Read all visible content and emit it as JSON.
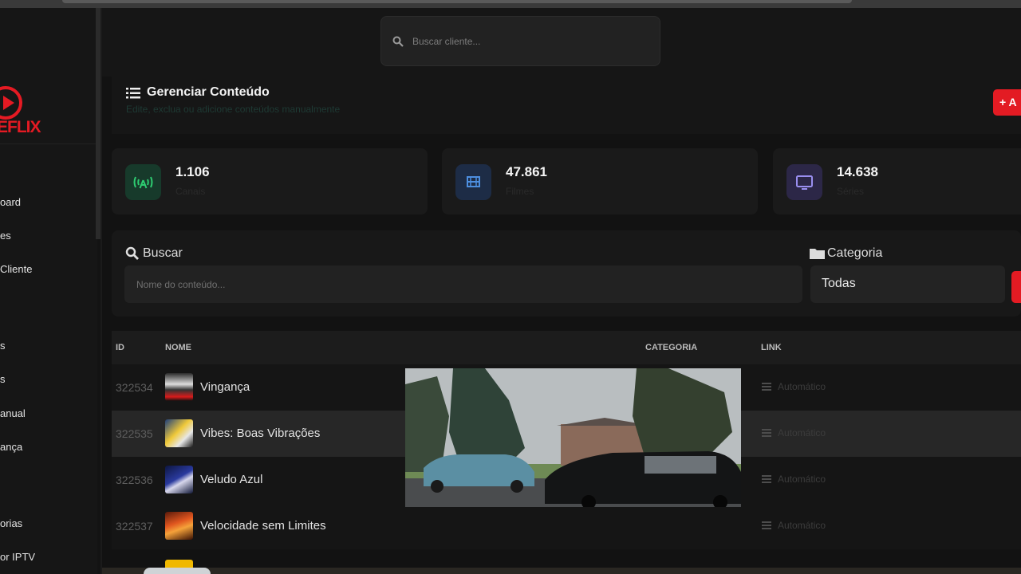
{
  "sidebar": {
    "logo_text": "EFLIX",
    "items": [
      {
        "label": "oard"
      },
      {
        "label": "es"
      },
      {
        "label": "Cliente"
      },
      {
        "label": "s"
      },
      {
        "label": "s"
      },
      {
        "label": "anual"
      },
      {
        "label": "ança"
      },
      {
        "label": "orias"
      },
      {
        "label": "or IPTV"
      }
    ]
  },
  "topbar": {
    "search_placeholder": "Buscar cliente..."
  },
  "header": {
    "title": "Gerenciar Conteúdo",
    "subtitle": "Edite, exclua ou adicione conteúdos manualmente",
    "add_button": "+ A"
  },
  "stats": [
    {
      "value": "1.106",
      "label": "Canais",
      "icon": "broadcast-icon",
      "color": "#2ecc71"
    },
    {
      "value": "47.861",
      "label": "Filmes",
      "icon": "film-icon",
      "color": "#4d8fe0"
    },
    {
      "value": "14.638",
      "label": "Séries",
      "icon": "tv-icon",
      "color": "#8f83e6"
    }
  ],
  "filters": {
    "search_label": "Buscar",
    "search_placeholder": "Nome do conteúdo...",
    "category_label": "Categoria",
    "category_value": "Todas"
  },
  "table": {
    "columns": [
      "ID",
      "NOME",
      "CATEGORIA",
      "LINK"
    ],
    "rows": [
      {
        "id": "322534",
        "name": "Vingança",
        "link": "Automático"
      },
      {
        "id": "322535",
        "name": "Vibes: Boas Vibrações",
        "link": "Automático"
      },
      {
        "id": "322536",
        "name": "Veludo Azul",
        "link": "Automático"
      },
      {
        "id": "322537",
        "name": "Velocidade sem Limites",
        "link": "Automático"
      }
    ]
  },
  "colors": {
    "accent": "#e31b23",
    "background": "#121212",
    "card": "#1a1a1a"
  }
}
